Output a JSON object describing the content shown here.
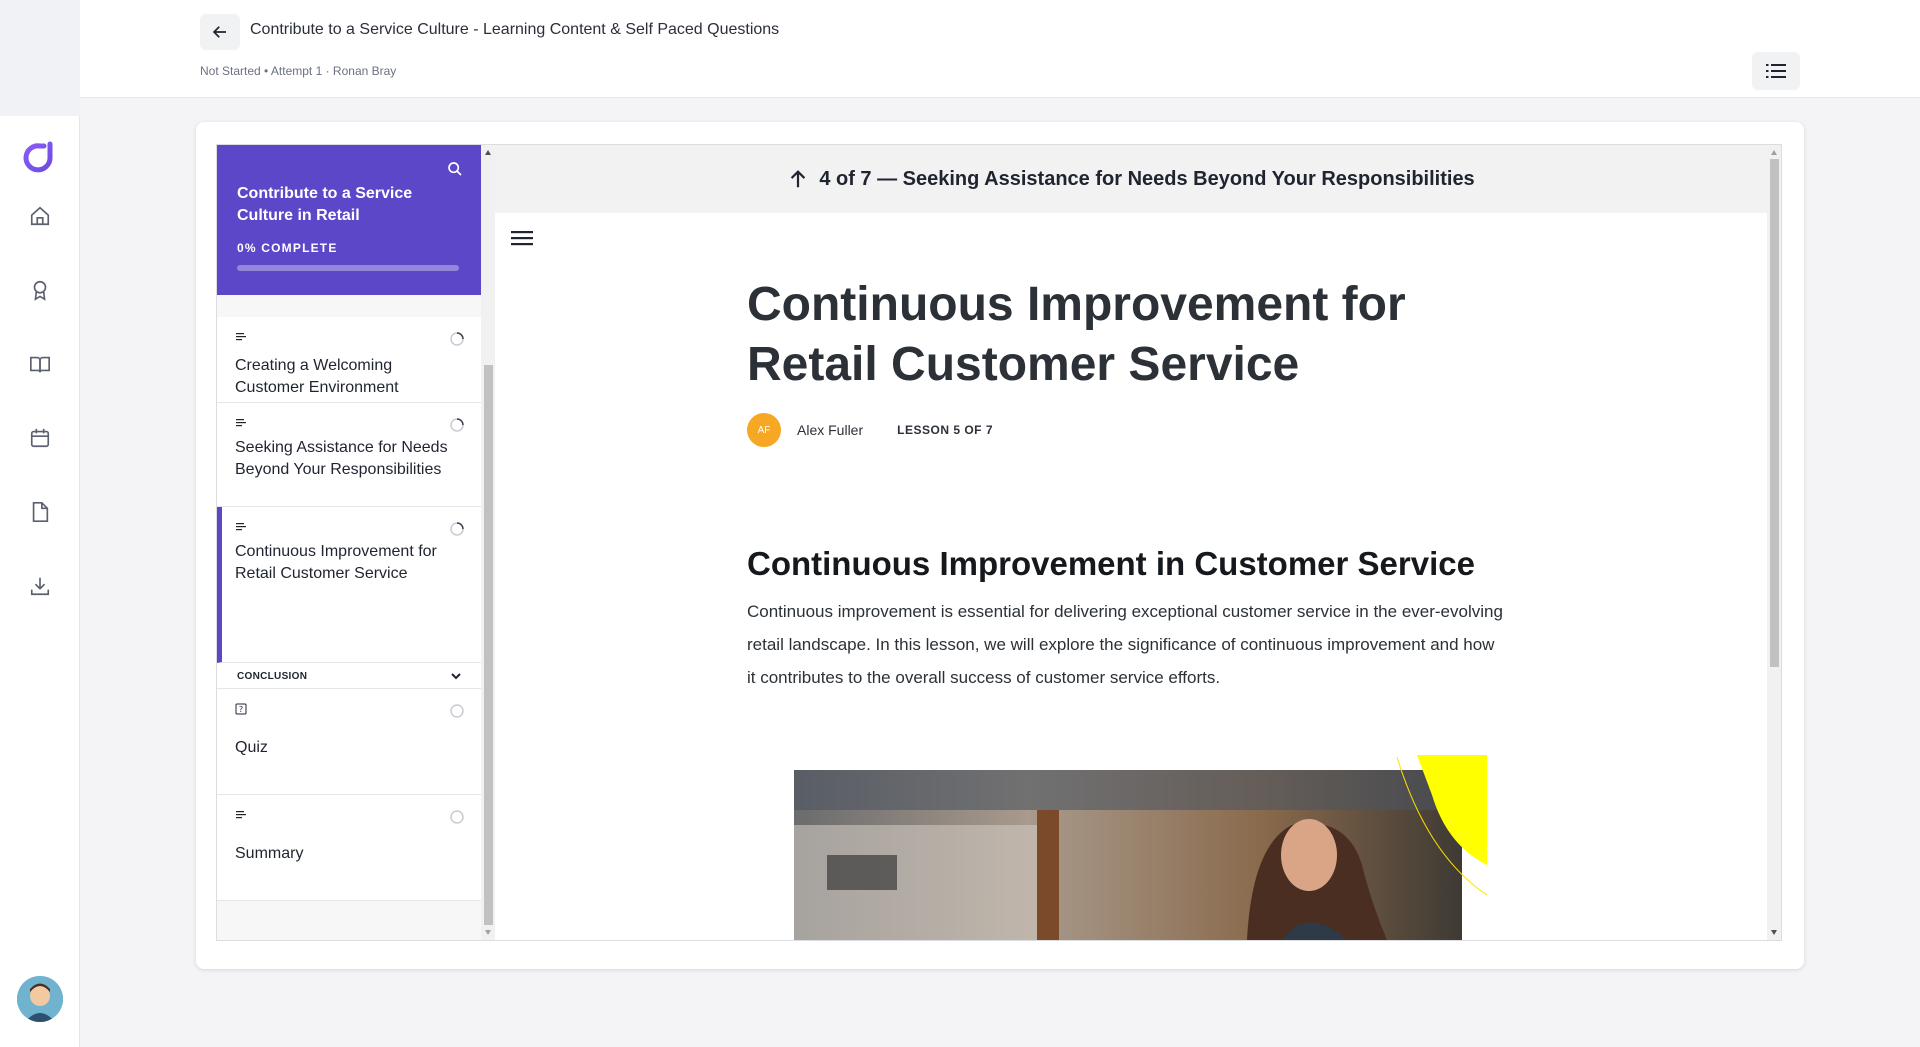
{
  "header": {
    "title": "Contribute to a Service Culture - Learning Content & Self Paced Questions",
    "meta": "Not Started • Attempt 1 · Ronan Bray"
  },
  "sidebar": {
    "course_title": "Contribute to a Service Culture in Retail",
    "progress_label": "0% COMPLETE",
    "progress_fraction": 0,
    "lessons": [
      {
        "name": "Creating a Welcoming Customer Environment",
        "type_icon": "text-lesson-icon",
        "status_icon": "in-progress-icon"
      },
      {
        "name": "Seeking Assistance for Needs Beyond Your Responsibilities",
        "type_icon": "text-lesson-icon",
        "status_icon": "in-progress-icon"
      },
      {
        "name": "Continuous Improvement for Retail Customer Service",
        "type_icon": "text-lesson-icon",
        "status_icon": "in-progress-icon",
        "active": true
      }
    ],
    "section": {
      "name": "CONCLUSION"
    },
    "conclusion_items": [
      {
        "name": "Quiz",
        "type_icon": "quiz-icon",
        "status_icon": "not-started-icon"
      },
      {
        "name": "Summary",
        "type_icon": "text-lesson-icon",
        "status_icon": "not-started-icon"
      }
    ]
  },
  "main": {
    "prev_lesson": "4 of 7 — Seeking Assistance for Needs Beyond Your Responsibilities",
    "lesson_title": "Continuous Improvement for Retail Customer Service",
    "author_initials": "AF",
    "author_name": "Alex Fuller",
    "lesson_count": "LESSON 5 OF 7",
    "section_title": "Continuous Improvement in Customer Service",
    "paragraph": "Continuous improvement is essential for delivering exceptional customer service in the ever-evolving retail landscape. In this lesson, we will explore the significance of continuous improvement and how it contributes to the overall success of customer service efforts."
  },
  "colors": {
    "accent": "#5b47c8",
    "author_avatar": "#f6a723",
    "hero_accent": "#ffff00"
  }
}
